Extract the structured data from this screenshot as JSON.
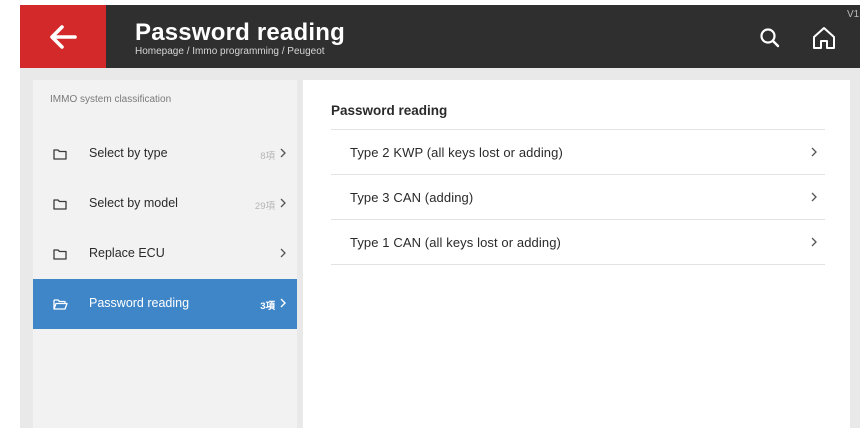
{
  "header": {
    "title": "Password reading",
    "breadcrumb": "Homepage / Immo programming / Peugeot",
    "version": "V1.",
    "back_icon": "arrow-left-icon",
    "search_icon": "search-icon",
    "home_icon": "home-icon"
  },
  "colors": {
    "header_bg": "#2f2f2f",
    "back_button_bg": "#d3292a",
    "active_item_bg": "#3e86c8",
    "content_bg": "#e9e9e9",
    "sidebar_bg": "#f2f2f2"
  },
  "sidebar": {
    "title": "IMMO system classification",
    "items": [
      {
        "label": "Select by type",
        "count": "8項",
        "icon": "folder-icon",
        "active": false
      },
      {
        "label": "Select by model",
        "count": "29項",
        "icon": "folder-icon",
        "active": false
      },
      {
        "label": "Replace ECU",
        "count": "",
        "icon": "folder-icon",
        "active": false
      },
      {
        "label": "Password reading",
        "count": "3項",
        "icon": "folder-open-icon",
        "active": true
      }
    ]
  },
  "main": {
    "title": "Password reading",
    "items": [
      {
        "label": "Type 2 KWP (all keys lost or adding)"
      },
      {
        "label": "Type 3 CAN (adding)"
      },
      {
        "label": "Type 1 CAN (all keys lost or adding)"
      }
    ]
  }
}
